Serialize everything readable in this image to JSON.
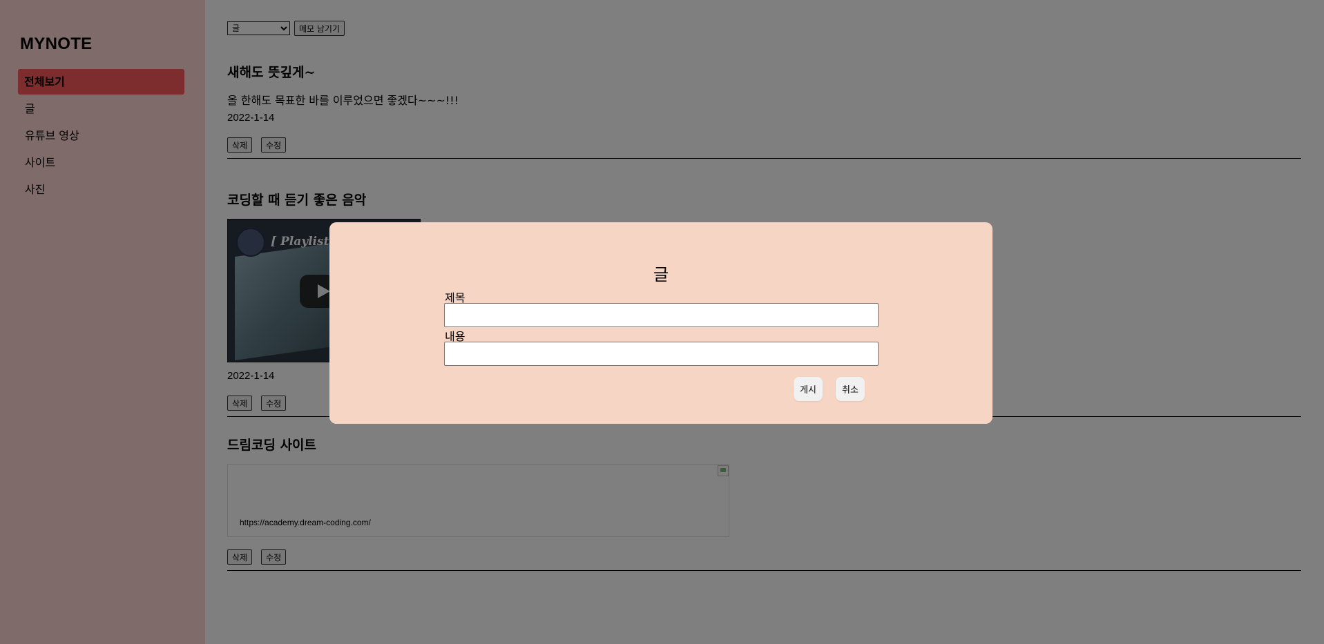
{
  "sidebar": {
    "logo": "MYNOTE",
    "items": [
      {
        "label": "전체보기",
        "active": true
      },
      {
        "label": "글",
        "active": false
      },
      {
        "label": "유튜브 영상",
        "active": false
      },
      {
        "label": "사이트",
        "active": false
      },
      {
        "label": "사진",
        "active": false
      }
    ]
  },
  "toolbar": {
    "select_value": "글",
    "memo_button": "메모 남기기"
  },
  "posts": [
    {
      "title": "새해도 뜻깊게~",
      "body": "올 한해도 목표한 바를 이루었으면 좋겠다~~~!!!",
      "date": "2022-1-14",
      "delete_label": "삭제",
      "edit_label": "수정"
    },
    {
      "title": "코딩할 때 듣기 좋은 음악",
      "video_title": "[ Playlist",
      "date": "2022-1-14",
      "delete_label": "삭제",
      "edit_label": "수정"
    },
    {
      "title": "드림코딩 사이트",
      "url": "https://academy.dream-coding.com/",
      "delete_label": "삭제",
      "edit_label": "수정"
    }
  ],
  "modal": {
    "title": "글",
    "title_label": "제목",
    "title_value": "",
    "content_label": "내용",
    "content_value": "",
    "submit_label": "게시",
    "cancel_label": "취소"
  },
  "colors": {
    "sidebar_bg": "#fdd6d4",
    "active_item": "#fa5a5a",
    "modal_bg": "#f6d5c4",
    "overlay": "rgba(0,0,0,0.5)"
  }
}
